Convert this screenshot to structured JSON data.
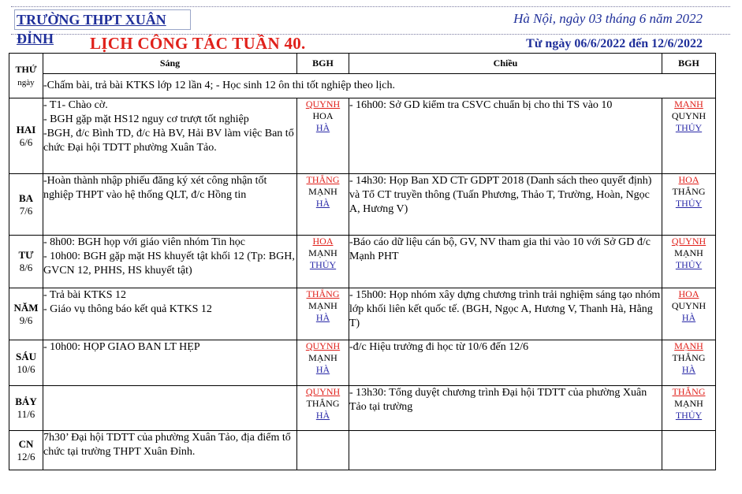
{
  "header": {
    "school": "TRƯỜNG THPT XUÂN ĐỈNH",
    "dateline": "Hà Nội, ngày 03 tháng 6  năm 2022",
    "title": "LỊCH CÔNG TÁC TUẦN 40.",
    "range": "Từ ngày 06/6/2022 đến 12/6/2022"
  },
  "columns": {
    "day_top": "THỨ",
    "day_bottom": "ngày",
    "morning": "Sáng",
    "bgh1": "BGH",
    "afternoon": "Chiều",
    "bgh2": "BGH"
  },
  "week_note": "-Chấm bài, trả bài KTKS lớp 12 lần 4;  - Học sinh 12 ôn thi tốt nghiệp theo lịch.",
  "days": [
    {
      "name": "HAI",
      "date": "6/6",
      "morning": [
        "- T1- Chào cờ.",
        "- BGH gặp mặt HS12 nguy cơ trượt tốt nghiệp",
        "-BGH, đ/c Bình TD, đ/c Hà BV, Hải BV làm việc Ban tổ chức Đại hội TDTT phường Xuân Tảo."
      ],
      "bgh_morning": [
        {
          "name": "QUYNH",
          "style": "red"
        },
        {
          "name": "HOA",
          "style": "plain"
        },
        {
          "name": "HÀ",
          "style": "blue"
        }
      ],
      "afternoon": [
        " - 16h00: Sở GD kiểm tra CSVC chuẩn bị cho thi TS vào 10"
      ],
      "bgh_afternoon": [
        {
          "name": "MẠNH",
          "style": "red"
        },
        {
          "name": "QUYNH",
          "style": "plain"
        },
        {
          "name": "THỦY",
          "style": "blue"
        }
      ]
    },
    {
      "name": "BA",
      "date": "7/6",
      "morning": [
        "-Hoàn thành nhập phiếu đăng ký xét công nhận tốt nghiệp THPT vào hệ thống QLT, đ/c Hồng tin"
      ],
      "bgh_morning": [
        {
          "name": "THẮNG",
          "style": "red"
        },
        {
          "name": "MẠNH",
          "style": "plain"
        },
        {
          "name": "HÀ",
          "style": "blue"
        }
      ],
      "afternoon": [
        " - 14h30: Họp Ban XD CTr GDPT 2018 (Danh sách theo quyết định) và Tổ CT truyền thông (Tuấn Phương, Thảo T, Trường, Hoàn, Ngọc A, Hương V)"
      ],
      "bgh_afternoon": [
        {
          "name": "HOA",
          "style": "red"
        },
        {
          "name": "THẮNG",
          "style": "plain"
        },
        {
          "name": "THỦY",
          "style": "blue"
        }
      ]
    },
    {
      "name": "TƯ",
      "date": "8/6",
      "morning": [
        " - 8h00: BGH họp với giáo viên nhóm Tin học",
        " - 10h00: BGH gặp mặt HS khuyết tật khối 12 (Tp: BGH, GVCN 12, PHHS, HS khuyết tật)"
      ],
      "bgh_morning": [
        {
          "name": "HOA",
          "style": "red"
        },
        {
          "name": "MẠNH",
          "style": "plain"
        },
        {
          "name": "THỦY",
          "style": "blue"
        }
      ],
      "afternoon": [
        "-Báo cáo dữ liệu cán bộ, GV, NV tham gia thi vào 10 với Sở GD đ/c Mạnh PHT"
      ],
      "bgh_afternoon": [
        {
          "name": "QUYNH",
          "style": "red"
        },
        {
          "name": "MẠNH",
          "style": "plain"
        },
        {
          "name": "THỦY",
          "style": "blue"
        }
      ]
    },
    {
      "name": "NĂM",
      "date": "9/6",
      "morning": [
        " - Trả bài KTKS 12",
        " - Giáo vụ thông báo kết quả KTKS 12"
      ],
      "bgh_morning": [
        {
          "name": "THẮNG",
          "style": "red"
        },
        {
          "name": "MẠNH",
          "style": "plain"
        },
        {
          "name": "HÀ",
          "style": "blue"
        }
      ],
      "afternoon": [
        " - 15h00: Họp nhóm xây dựng chương trình trải nghiệm sáng tạo nhóm lớp khối liên kết quốc tế. (BGH, Ngọc A, Hương V, Thanh Hà, Hằng T)"
      ],
      "bgh_afternoon": [
        {
          "name": "HOA",
          "style": "red"
        },
        {
          "name": "QUYNH",
          "style": "plain"
        },
        {
          "name": "HÀ",
          "style": "blue"
        }
      ]
    },
    {
      "name": "SÁU",
      "date": "10/6",
      "morning": [
        " - 10h00: HỌP GIAO BAN LT HẸP"
      ],
      "bgh_morning": [
        {
          "name": "QUYNH",
          "style": "red"
        },
        {
          "name": "MẠNH",
          "style": "plain"
        },
        {
          "name": "HÀ",
          "style": "blue"
        }
      ],
      "afternoon": [
        "-đ/c Hiệu trưởng đi học từ 10/6 đến 12/6"
      ],
      "bgh_afternoon": [
        {
          "name": "MẠNH",
          "style": "red"
        },
        {
          "name": "THẮNG",
          "style": "plain"
        },
        {
          "name": "HÀ",
          "style": "blue"
        }
      ]
    },
    {
      "name": "BẢY",
      "date": "11/6",
      "morning": [
        ""
      ],
      "bgh_morning": [
        {
          "name": "QUYNH",
          "style": "red"
        },
        {
          "name": "THẮNG",
          "style": "plain"
        },
        {
          "name": "HÀ",
          "style": "blue"
        }
      ],
      "afternoon": [
        " - 13h30: Tổng duyệt chương trình Đại hội TDTT của phường Xuân Tảo tại trường"
      ],
      "bgh_afternoon": [
        {
          "name": "THẮNG",
          "style": "red"
        },
        {
          "name": "MẠNH",
          "style": "plain"
        },
        {
          "name": "THỦY",
          "style": "blue"
        }
      ]
    },
    {
      "name": "CN",
      "date": "12/6",
      "morning": [
        "7h30’ Đại hội TDTT của phường Xuân Tảo, địa điểm tổ chức tại trường THPT Xuân Đỉnh."
      ],
      "bgh_morning": [],
      "afternoon": [
        ""
      ],
      "bgh_afternoon": []
    }
  ]
}
